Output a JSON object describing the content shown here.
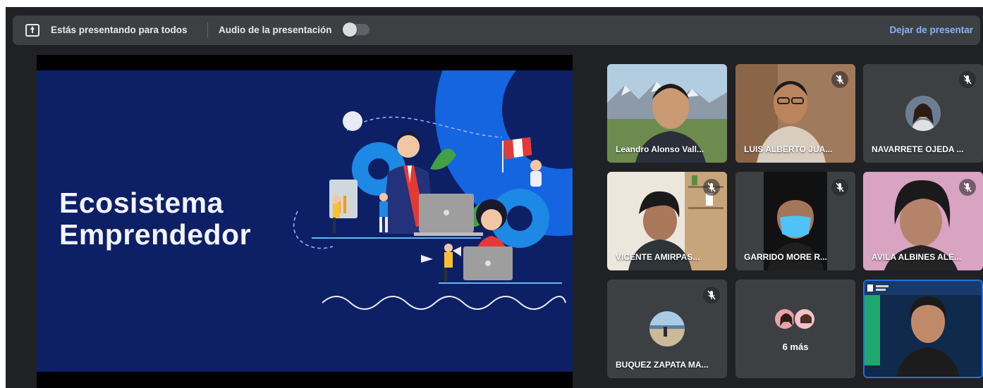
{
  "topbar": {
    "presenting_text": "Estás presentando para todos",
    "audio_label": "Audio de la presentación",
    "audio_toggle_on": false,
    "stop_label": "Dejar de presentar"
  },
  "slide": {
    "title_line1": "Ecosistema",
    "title_line2": "Emprendedor"
  },
  "participants": [
    {
      "name": "Leandro Alonso Vall...",
      "muted": false
    },
    {
      "name": "LUIS ALBERTO JUA...",
      "muted": true
    },
    {
      "name": "NAVARRETE OJEDA ...",
      "muted": true
    },
    {
      "name": "VICENTE AMIRPAS...",
      "muted": true
    },
    {
      "name": "GARRIDO MORE R...",
      "muted": true
    },
    {
      "name": "AVILA ALBINES ALE...",
      "muted": true
    },
    {
      "name": "BUQUEZ ZAPATA MA...",
      "muted": true
    },
    {
      "more_label": "6 más"
    },
    {
      "name": "",
      "active_speaker": true
    }
  ],
  "colors": {
    "background": "#202124",
    "bar": "#3c4043",
    "accent": "#8ab4f8",
    "slide_bg": "#0d2066",
    "active_border": "#1a73e8"
  }
}
